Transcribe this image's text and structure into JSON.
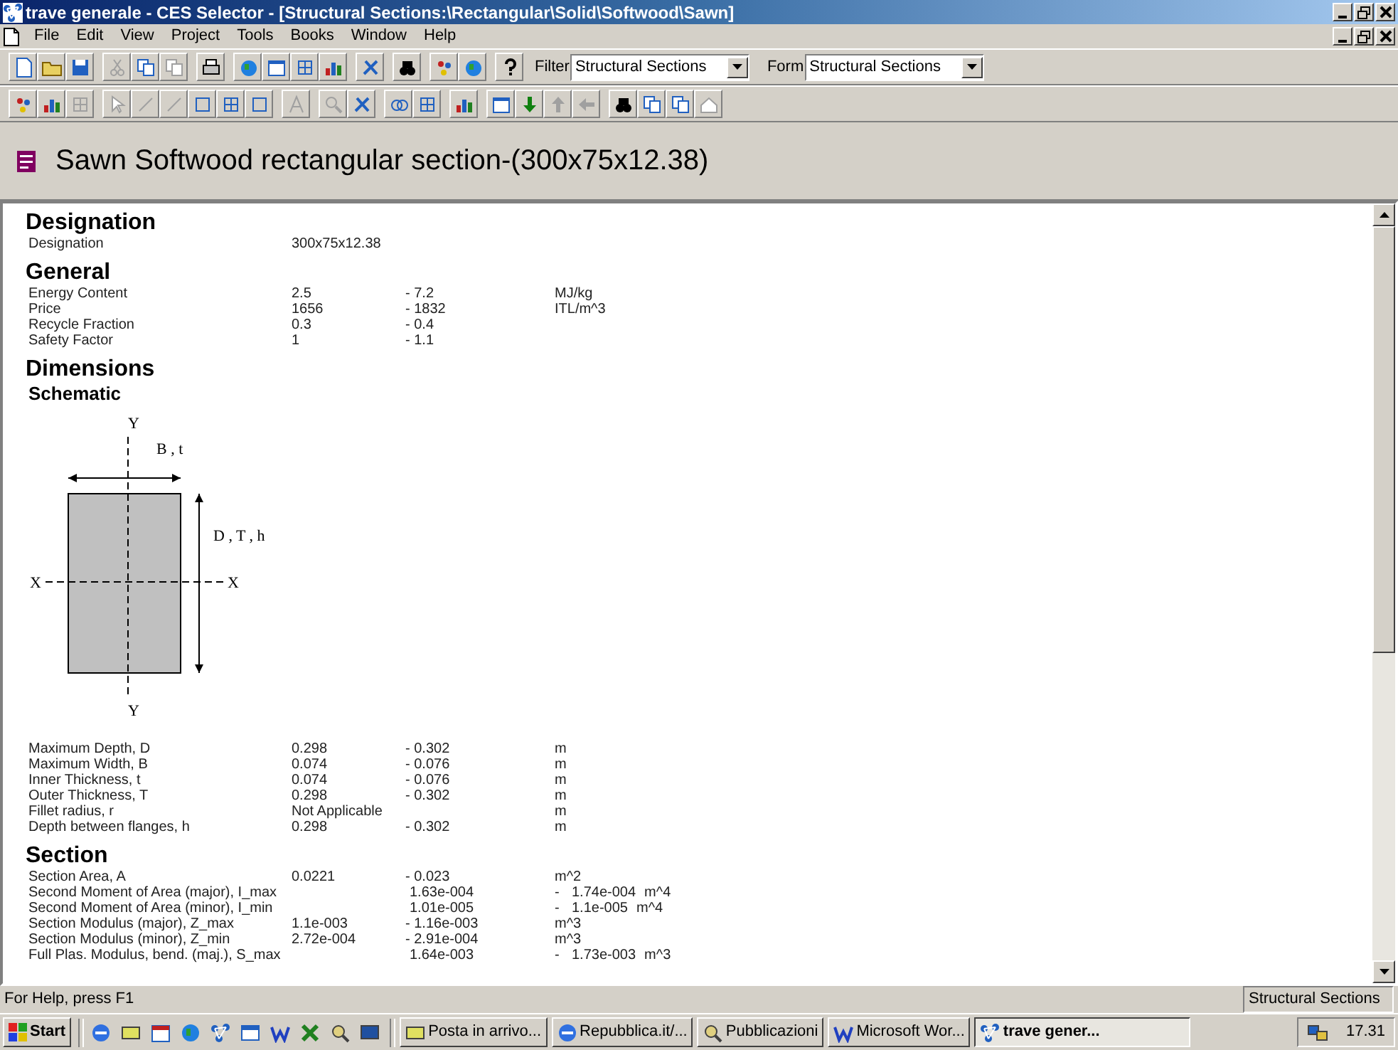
{
  "window": {
    "title": "trave generale - CES Selector - [Structural Sections:\\Rectangular\\Solid\\Softwood\\Sawn]"
  },
  "menu": [
    "File",
    "Edit",
    "View",
    "Project",
    "Tools",
    "Books",
    "Window",
    "Help"
  ],
  "filter": {
    "label": "Filter",
    "value": "Structural Sections"
  },
  "form": {
    "label": "Form",
    "value": "Structural Sections"
  },
  "record_title": "Sawn Softwood rectangular section-(300x75x12.38)",
  "sections": [
    {
      "kind": "table",
      "heading": "Designation",
      "rows": [
        {
          "kind": "standard",
          "label": "Designation",
          "min": "300x75x12.38"
        }
      ]
    },
    {
      "kind": "table",
      "heading": "General",
      "rows": [
        {
          "kind": "standard",
          "label": "Energy Content",
          "min": "2.5",
          "max": "- 7.2",
          "unit": "MJ/kg"
        },
        {
          "kind": "standard",
          "label": "Price",
          "min": "1656",
          "max": "- 1832",
          "unit": "ITL/m^3"
        },
        {
          "kind": "standard",
          "label": "Recycle Fraction",
          "min": "0.3",
          "max": "- 0.4"
        },
        {
          "kind": "standard",
          "label": "Safety Factor",
          "min": "1",
          "max": "- 1.1"
        }
      ]
    },
    {
      "kind": "schematic",
      "heading": "Dimensions",
      "subheading": "Schematic",
      "labels": {
        "y_top": "Y",
        "y_bottom": "Y",
        "x_left": "X",
        "x_right": "X",
        "width": "B , t",
        "depth": "D , T , h"
      }
    },
    {
      "kind": "table",
      "rows": [
        {
          "kind": "standard",
          "label": "Maximum Depth, D",
          "min": "0.298",
          "max": "- 0.302",
          "unit": "m"
        },
        {
          "kind": "standard",
          "label": "Maximum Width, B",
          "min": "0.074",
          "max": "- 0.076",
          "unit": "m"
        },
        {
          "kind": "standard",
          "label": "Inner Thickness, t",
          "min": "0.074",
          "max": "- 0.076",
          "unit": "m"
        },
        {
          "kind": "standard",
          "label": "Outer Thickness, T",
          "min": "0.298",
          "max": "- 0.302",
          "unit": "m"
        },
        {
          "kind": "standard",
          "label": "Fillet radius, r",
          "min": "Not Applicable",
          "unit": "m"
        },
        {
          "kind": "standard",
          "label": "Depth between flanges, h",
          "min": "0.298",
          "max": "- 0.302",
          "unit": "m"
        }
      ]
    },
    {
      "kind": "table",
      "heading": "Section",
      "rows": [
        {
          "kind": "standard",
          "label": "Section Area, A",
          "min": "0.0221",
          "max": "- 0.023",
          "unit": "m^2"
        },
        {
          "kind": "shifted",
          "label": "Second Moment of Area (major), I_max",
          "min": "1.63e-004",
          "dash": "-",
          "max": "1.74e-004",
          "unit": "m^4"
        },
        {
          "kind": "shifted",
          "label": "Second Moment of Area (minor), I_min",
          "min": "1.01e-005",
          "dash": "-",
          "max": "1.1e-005",
          "unit": "m^4"
        },
        {
          "kind": "standard",
          "label": "Section Modulus (major), Z_max",
          "min": "1.1e-003",
          "max": "- 1.16e-003",
          "unit": "m^3"
        },
        {
          "kind": "standard",
          "label": "Section Modulus (minor), Z_min",
          "min": "2.72e-004",
          "max": "- 2.91e-004",
          "unit": "m^3"
        },
        {
          "kind": "shifted",
          "label": "Full Plas. Modulus, bend. (maj.), S_max",
          "min": "1.64e-003",
          "dash": "-",
          "max": "1.73e-003",
          "unit": "m^3"
        }
      ]
    }
  ],
  "status_bar": {
    "help": "For Help, press F1",
    "panel": "Structural Sections"
  },
  "taskbar": {
    "start": "Start",
    "tasks": [
      {
        "label": "Posta in arrivo...",
        "selected": false
      },
      {
        "label": "Repubblica.it/...",
        "selected": false
      },
      {
        "label": "Pubblicazioni",
        "selected": false
      },
      {
        "label": "Microsoft Wor...",
        "selected": false
      },
      {
        "label": "trave gener...",
        "selected": true
      }
    ],
    "clock": "17.31"
  }
}
